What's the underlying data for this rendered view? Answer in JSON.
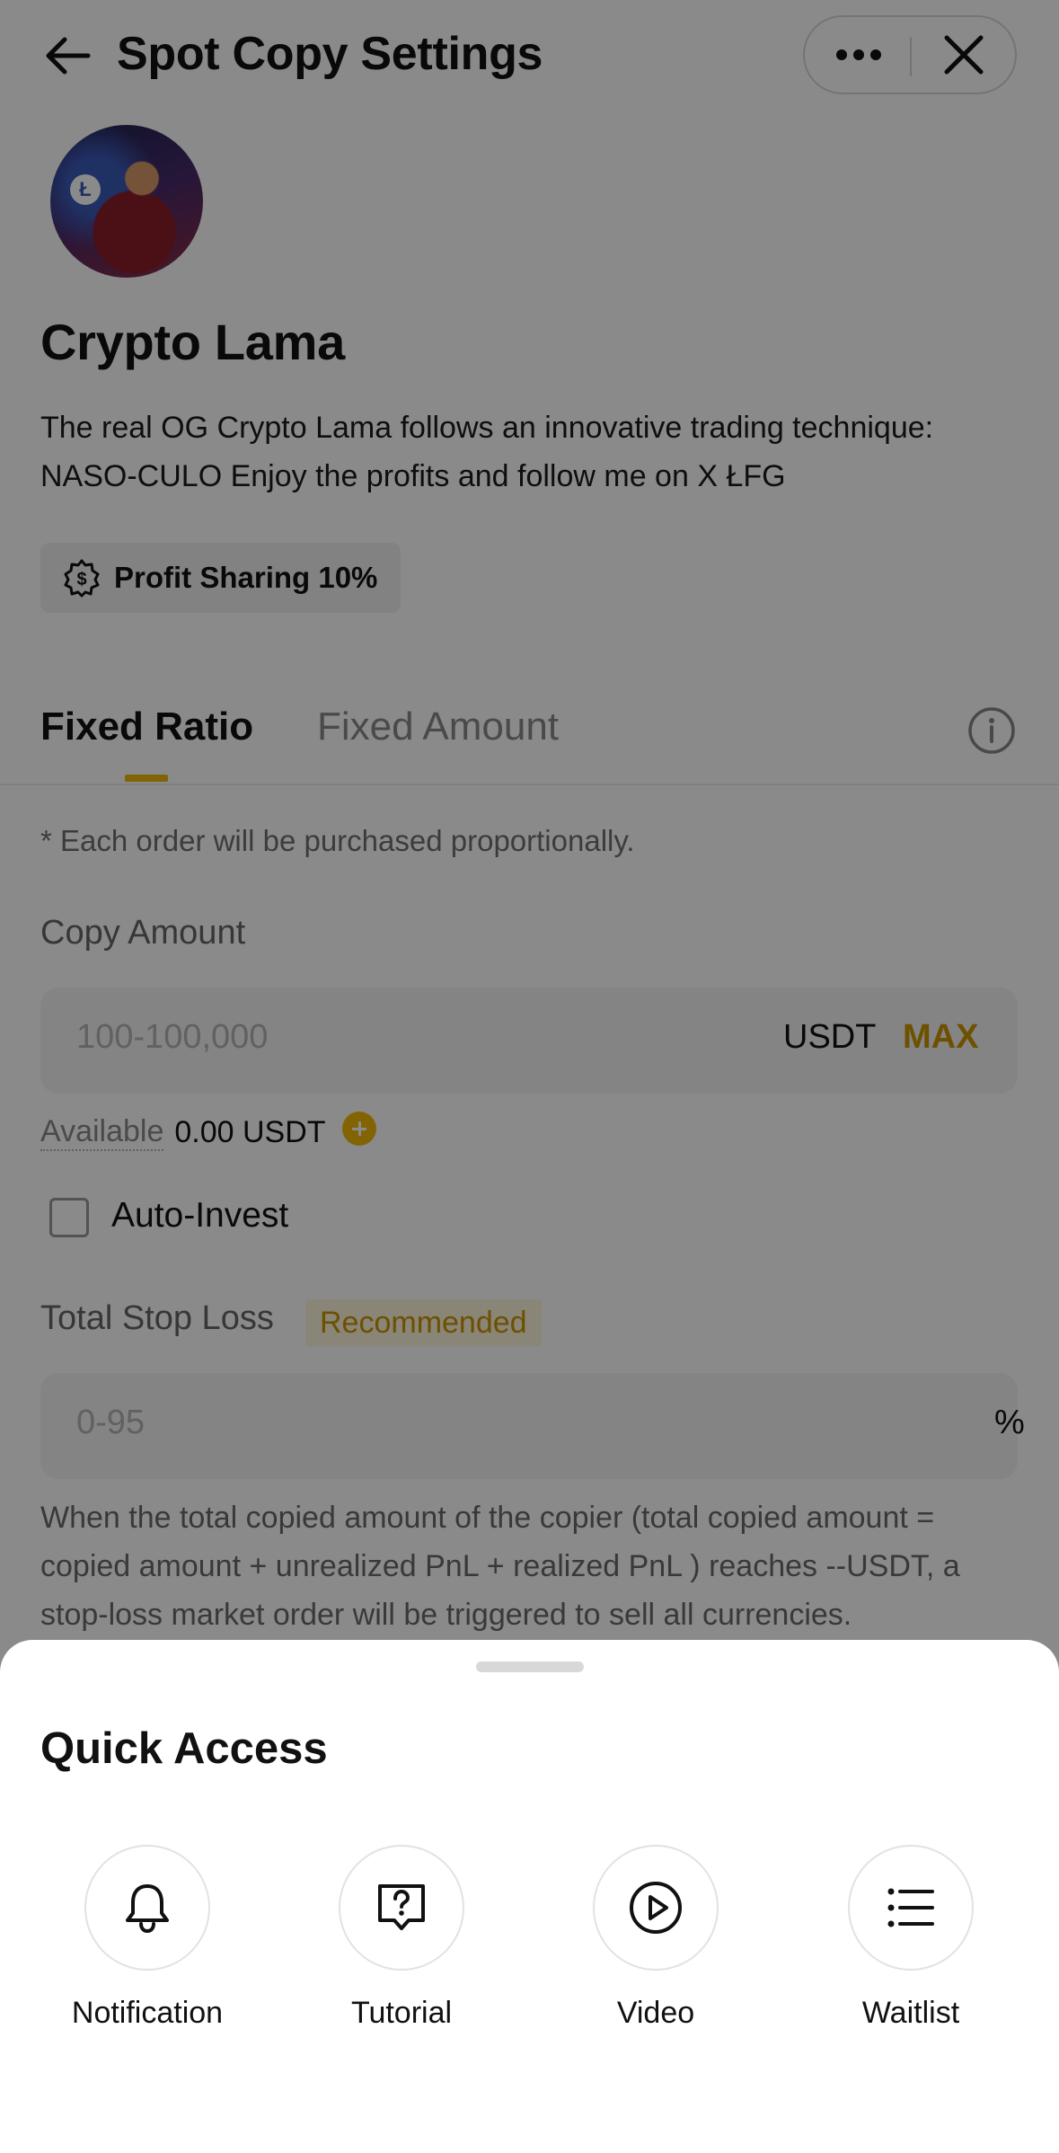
{
  "header": {
    "title": "Spot Copy Settings",
    "back_icon": "arrow-left-icon",
    "more_icon": "more-horizontal-icon",
    "close_icon": "close-icon"
  },
  "trader": {
    "name": "Crypto Lama",
    "bio": "The real OG Crypto Lama follows an innovative trading technique: NASO-CULO Enjoy the profits and follow me on X ŁFG",
    "avatar_letter": "Ł",
    "badge_label": "Profit Sharing 10%",
    "badge_icon": "dollar-gear-icon"
  },
  "tabs": [
    {
      "label": "Fixed Ratio",
      "active": true
    },
    {
      "label": "Fixed Amount",
      "active": false
    }
  ],
  "form": {
    "note": "* Each order will be purchased proportionally.",
    "copy_amount_label": "Copy Amount",
    "copy_amount_placeholder": "100-100,000",
    "copy_amount_value": "",
    "unit": "USDT",
    "max_label": "MAX",
    "available_label": "Available",
    "available_value": "0.00 USDT",
    "auto_invest_label": "Auto-Invest",
    "auto_invest_checked": false,
    "stop_loss_label": "Total Stop Loss",
    "recommended_label": "Recommended",
    "stop_loss_placeholder": "0-95",
    "stop_loss_value": "",
    "stop_loss_unit": "%",
    "stop_loss_description": "When the total copied amount of the copier (total copied amount = copied amount + unrealized PnL + realized PnL ) reaches --USDT, a stop-loss market order will be triggered to sell all currencies."
  },
  "quick_access": {
    "title": "Quick Access",
    "items": [
      {
        "label": "Notification",
        "icon": "bell-icon"
      },
      {
        "label": "Tutorial",
        "icon": "question-chat-icon"
      },
      {
        "label": "Video",
        "icon": "play-circle-icon"
      },
      {
        "label": "Waitlist",
        "icon": "list-icon"
      }
    ]
  },
  "colors": {
    "accent": "#f0b90b",
    "accent_text": "#c99400",
    "overlay": "rgba(0,0,0,0.46)"
  }
}
